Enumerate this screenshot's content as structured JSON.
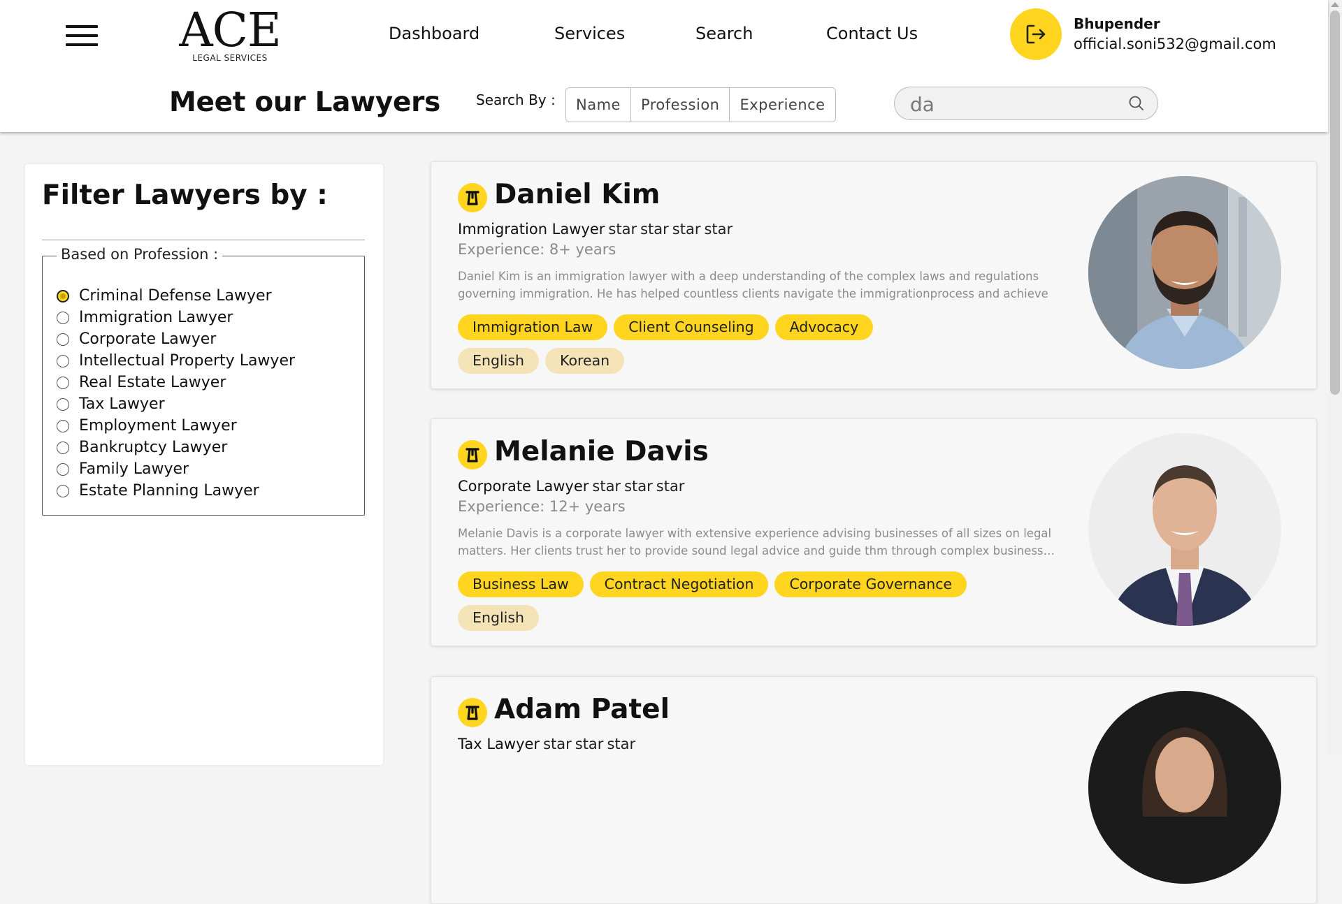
{
  "header": {
    "logo_main": "ACE",
    "logo_sub": "LEGAL SERVICES",
    "nav": [
      "Dashboard",
      "Services",
      "Search",
      "Contact Us"
    ],
    "user": {
      "name": "Bhupender",
      "email": "official.soni532@gmail.com"
    },
    "page_title": "Meet our Lawyers",
    "search_by_label": "Search By :",
    "search_tabs": [
      "Name",
      "Profession",
      "Experience"
    ],
    "search_value": "da",
    "accent_color": "#ffd51f"
  },
  "filter": {
    "title": "Filter Lawyers by :",
    "legend": "Based on Profession :",
    "options": [
      "Criminal Defense Lawyer",
      "Immigration Lawyer",
      "Corporate Lawyer",
      "Intellectual Property Lawyer",
      "Real Estate Lawyer",
      "Tax Lawyer",
      "Employment Lawyer",
      "Bankruptcy Lawyer",
      "Family Lawyer",
      "Estate Planning Lawyer"
    ],
    "selected": "Criminal Defense Lawyer"
  },
  "lawyers": [
    {
      "name": "Daniel Kim",
      "profession": "Immigration Lawyer",
      "stars": [
        "star",
        "star",
        "star",
        "star"
      ],
      "experience": "Experience: 8+ years",
      "description": "Daniel Kim is an immigration lawyer with a deep understanding of the complex laws and regulations governing immigration. He has helped countless clients navigate the immigrationprocess and achieve their…",
      "skills": [
        "Immigration Law",
        "Client Counseling",
        "Advocacy"
      ],
      "languages": [
        "English",
        "Korean"
      ]
    },
    {
      "name": "Melanie Davis",
      "profession": "Corporate Lawyer",
      "stars": [
        "star",
        "star",
        "star"
      ],
      "experience": "Experience: 12+ years",
      "description": "Melanie Davis is a corporate lawyer with extensive experience advising businesses of all sizes on legal matters. Her clients trust her to provide sound legal advice and guide thm through complex business…",
      "skills": [
        "Business Law",
        "Contract Negotiation",
        "Corporate Governance"
      ],
      "languages": [
        "English"
      ]
    },
    {
      "name": "Adam Patel",
      "profession": "Tax Lawyer",
      "stars": [
        "star",
        "star",
        "star"
      ]
    }
  ]
}
